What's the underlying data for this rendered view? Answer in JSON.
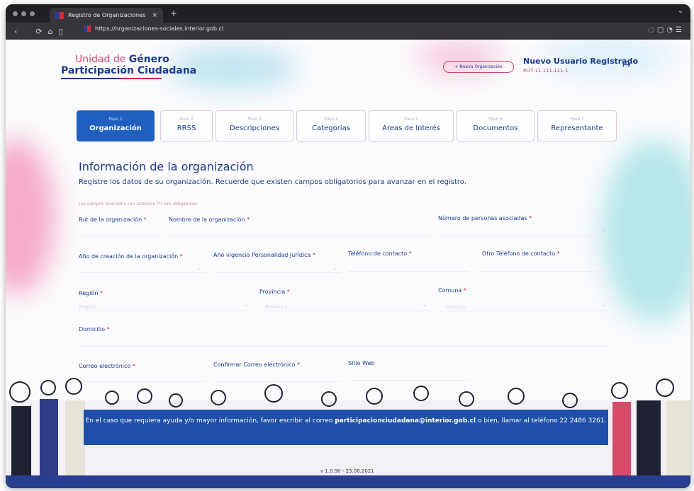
{
  "browser": {
    "tab_title": "Registro de Organizaciones",
    "tab_close": "×",
    "new_tab": "+",
    "url": "https://organizaciones-sociales.interior.gob.cl"
  },
  "header": {
    "logo_line1_prefix": "Unidad de",
    "logo_line1_bold": "Género",
    "logo_line2": "Participación Ciudadana",
    "new_org_button": "+ Nueva Organización",
    "user_name": "Nuevo Usuario Registrado",
    "user_rut": "RUT 11.111.111-1"
  },
  "steps": [
    {
      "num": "Paso 1",
      "name": "Organización"
    },
    {
      "num": "Paso 2",
      "name": "RRSS"
    },
    {
      "num": "Paso 3",
      "name": "Descripciones"
    },
    {
      "num": "Paso 4",
      "name": "Categorías"
    },
    {
      "num": "Paso 5",
      "name": "Areas de Interés"
    },
    {
      "num": "Paso 6",
      "name": "Documentos"
    },
    {
      "num": "Paso 7",
      "name": "Representante"
    }
  ],
  "form": {
    "title": "Información de la organización",
    "subtitle": "Registre los datos de su organización. Recuerde que existen campos obligatorios para avanzar en el registro.",
    "required_note": "Los campos marcados con asterisco (*) son obligatorios",
    "fields": {
      "rut": "Rut de la organización",
      "nombre": "Nombre de la organización",
      "personas": "Número de personas asociadas",
      "anio_creacion": "Año de creación de la organización",
      "anio_vigencia": "Año vigencia Personalidad Jurídica",
      "telefono": "Teléfono de contacto",
      "otro_telefono": "Otro Teléfono de contacto",
      "region": "Región",
      "provincia": "Provincia",
      "comuna": "Comuna",
      "domicilio": "Domicilio",
      "correo": "Correo electrónico",
      "confirmar_correo": "Confirmar Correo electrónico",
      "sitio_web": "Sitio Web"
    },
    "placeholders": {
      "region": "Región",
      "provincia": "Provincia",
      "comuna": "Comuna"
    },
    "required_mark": "*"
  },
  "help": {
    "text_before": "En el caso que requiera ayuda y/o mayor información, favor escribir al correo",
    "email": "participacionciudadana@interior.gob.cl",
    "text_after": "o bien, llamar al teléfono 22 2486 3261."
  },
  "version": "v 1.0.90 - 23.08.2021",
  "colors": {
    "primary": "#1c3b8c",
    "active_step": "#1f5fbf",
    "accent_pink": "#d44a6b",
    "help_banner": "#1f4fa8"
  }
}
